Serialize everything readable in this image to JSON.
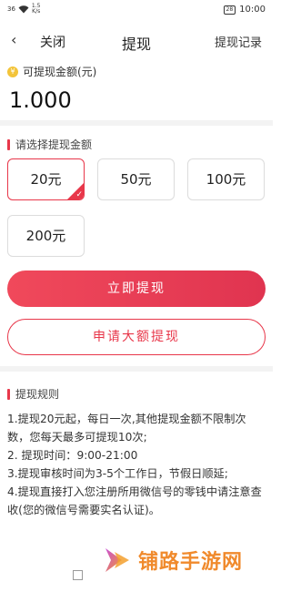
{
  "status_bar": {
    "signal": "36",
    "speed_value": "1.5",
    "speed_unit": "K/s",
    "battery": "28",
    "time": "10:00"
  },
  "nav": {
    "back_icon": "chevron-left-icon",
    "close_label": "关闭",
    "title": "提现",
    "records_label": "提现记录"
  },
  "balance": {
    "coin_icon_glyph": "¥",
    "label": "可提现金额(元)",
    "value": "1.000"
  },
  "amount_selection": {
    "label": "请选择提现金额",
    "options": [
      "20元",
      "50元",
      "100元",
      "200元"
    ],
    "selected": "20元"
  },
  "actions": {
    "withdraw_now": "立即提现",
    "apply_large": "申请大额提现"
  },
  "rules": {
    "title": "提现规则",
    "lines": [
      "1.提现20元起，每日一次,其他提现金额不限制次数，您每天最多可提现10次;",
      "2. 提现时间：9:00-21:00",
      "3.提现审核时间为3-5个工作日，节假日顺延;",
      "4.提现直接打入您注册所用微信号的零钱中请注意查收(您的微信号需要实名认证)。"
    ]
  },
  "watermark": {
    "text": "铺路手游网"
  },
  "colors": {
    "accent": "#e8374a",
    "watermark": "#f08a2c"
  }
}
